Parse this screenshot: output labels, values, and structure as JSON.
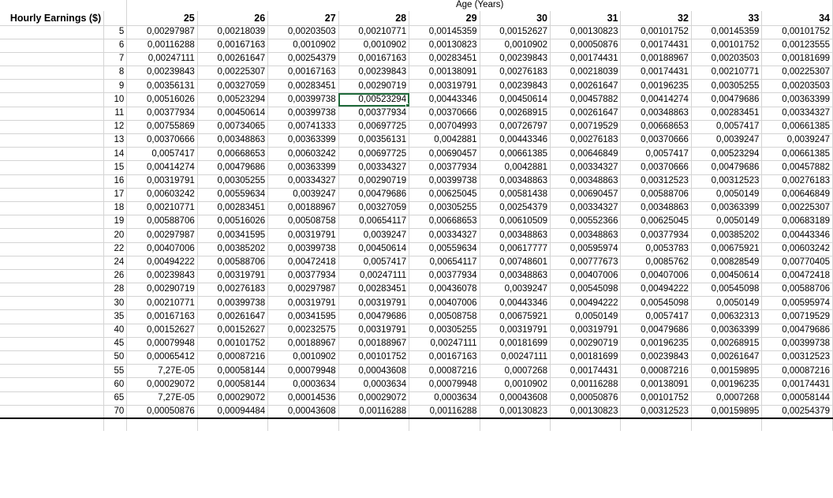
{
  "header": {
    "banner_title": "Age (Years)",
    "row_axis_label": "Hourly Earnings ($)",
    "columns": [
      "25",
      "26",
      "27",
      "28",
      "29",
      "30",
      "31",
      "32",
      "33",
      "34"
    ]
  },
  "selection": {
    "row_label": "10",
    "column_label": "28",
    "value": "0,00523294",
    "border_color": "#1f6b3b"
  },
  "chart_data": {
    "type": "table",
    "title": "Age (Years)",
    "xlabel": "Age (Years)",
    "ylabel": "Hourly Earnings ($)",
    "categories": [
      "25",
      "26",
      "27",
      "28",
      "29",
      "30",
      "31",
      "32",
      "33",
      "34"
    ],
    "row_labels": [
      "5",
      "6",
      "7",
      "8",
      "9",
      "10",
      "11",
      "12",
      "13",
      "14",
      "15",
      "16",
      "17",
      "18",
      "19",
      "20",
      "22",
      "24",
      "26",
      "28",
      "30",
      "35",
      "40",
      "45",
      "50",
      "55",
      "60",
      "65",
      "70"
    ],
    "rows": [
      {
        "label": "5",
        "values": [
          "0,00297987",
          "0,00218039",
          "0,00203503",
          "0,00210771",
          "0,00145359",
          "0,00152627",
          "0,00130823",
          "0,00101752",
          "0,00145359",
          "0,00101752"
        ]
      },
      {
        "label": "6",
        "values": [
          "0,00116288",
          "0,00167163",
          "0,0010902",
          "0,0010902",
          "0,00130823",
          "0,0010902",
          "0,00050876",
          "0,00174431",
          "0,00101752",
          "0,00123555"
        ]
      },
      {
        "label": "7",
        "values": [
          "0,00247111",
          "0,00261647",
          "0,00254379",
          "0,00167163",
          "0,00283451",
          "0,00239843",
          "0,00174431",
          "0,00188967",
          "0,00203503",
          "0,00181699"
        ]
      },
      {
        "label": "8",
        "values": [
          "0,00239843",
          "0,00225307",
          "0,00167163",
          "0,00239843",
          "0,00138091",
          "0,00276183",
          "0,00218039",
          "0,00174431",
          "0,00210771",
          "0,00225307"
        ]
      },
      {
        "label": "9",
        "values": [
          "0,00356131",
          "0,00327059",
          "0,00283451",
          "0,00290719",
          "0,00319791",
          "0,00239843",
          "0,00261647",
          "0,00196235",
          "0,00305255",
          "0,00203503"
        ]
      },
      {
        "label": "10",
        "values": [
          "0,00516026",
          "0,00523294",
          "0,00399738",
          "0,00523294",
          "0,00443346",
          "0,00450614",
          "0,00457882",
          "0,00414274",
          "0,00479686",
          "0,00363399"
        ]
      },
      {
        "label": "11",
        "values": [
          "0,00377934",
          "0,00450614",
          "0,00399738",
          "0,00377934",
          "0,00370666",
          "0,00268915",
          "0,00261647",
          "0,00348863",
          "0,00283451",
          "0,00334327"
        ]
      },
      {
        "label": "12",
        "values": [
          "0,00755869",
          "0,00734065",
          "0,00741333",
          "0,00697725",
          "0,00704993",
          "0,00726797",
          "0,00719529",
          "0,00668653",
          "0,0057417",
          "0,00661385"
        ]
      },
      {
        "label": "13",
        "values": [
          "0,00370666",
          "0,00348863",
          "0,00363399",
          "0,00356131",
          "0,0042881",
          "0,00443346",
          "0,00276183",
          "0,00370666",
          "0,0039247",
          "0,0039247"
        ]
      },
      {
        "label": "14",
        "values": [
          "0,0057417",
          "0,00668653",
          "0,00603242",
          "0,00697725",
          "0,00690457",
          "0,00661385",
          "0,00646849",
          "0,0057417",
          "0,00523294",
          "0,00661385"
        ]
      },
      {
        "label": "15",
        "values": [
          "0,00414274",
          "0,00479686",
          "0,00363399",
          "0,00334327",
          "0,00377934",
          "0,0042881",
          "0,00334327",
          "0,00370666",
          "0,00479686",
          "0,00457882"
        ]
      },
      {
        "label": "16",
        "values": [
          "0,00319791",
          "0,00305255",
          "0,00334327",
          "0,00290719",
          "0,00399738",
          "0,00348863",
          "0,00348863",
          "0,00312523",
          "0,00312523",
          "0,00276183"
        ]
      },
      {
        "label": "17",
        "values": [
          "0,00603242",
          "0,00559634",
          "0,0039247",
          "0,00479686",
          "0,00625045",
          "0,00581438",
          "0,00690457",
          "0,00588706",
          "0,0050149",
          "0,00646849"
        ]
      },
      {
        "label": "18",
        "values": [
          "0,00210771",
          "0,00283451",
          "0,00188967",
          "0,00327059",
          "0,00305255",
          "0,00254379",
          "0,00334327",
          "0,00348863",
          "0,00363399",
          "0,00225307"
        ]
      },
      {
        "label": "19",
        "values": [
          "0,00588706",
          "0,00516026",
          "0,00508758",
          "0,00654117",
          "0,00668653",
          "0,00610509",
          "0,00552366",
          "0,00625045",
          "0,0050149",
          "0,00683189"
        ]
      },
      {
        "label": "20",
        "values": [
          "0,00297987",
          "0,00341595",
          "0,00319791",
          "0,0039247",
          "0,00334327",
          "0,00348863",
          "0,00348863",
          "0,00377934",
          "0,00385202",
          "0,00443346"
        ]
      },
      {
        "label": "22",
        "values": [
          "0,00407006",
          "0,00385202",
          "0,00399738",
          "0,00450614",
          "0,00559634",
          "0,00617777",
          "0,00595974",
          "0,0053783",
          "0,00675921",
          "0,00603242"
        ]
      },
      {
        "label": "24",
        "values": [
          "0,00494222",
          "0,00588706",
          "0,00472418",
          "0,0057417",
          "0,00654117",
          "0,00748601",
          "0,00777673",
          "0,0085762",
          "0,00828549",
          "0,00770405"
        ]
      },
      {
        "label": "26",
        "values": [
          "0,00239843",
          "0,00319791",
          "0,00377934",
          "0,00247111",
          "0,00377934",
          "0,00348863",
          "0,00407006",
          "0,00407006",
          "0,00450614",
          "0,00472418"
        ]
      },
      {
        "label": "28",
        "values": [
          "0,00290719",
          "0,00276183",
          "0,00297987",
          "0,00283451",
          "0,00436078",
          "0,0039247",
          "0,00545098",
          "0,00494222",
          "0,00545098",
          "0,00588706"
        ]
      },
      {
        "label": "30",
        "values": [
          "0,00210771",
          "0,00399738",
          "0,00319791",
          "0,00319791",
          "0,00407006",
          "0,00443346",
          "0,00494222",
          "0,00545098",
          "0,0050149",
          "0,00595974"
        ]
      },
      {
        "label": "35",
        "values": [
          "0,00167163",
          "0,00261647",
          "0,00341595",
          "0,00479686",
          "0,00508758",
          "0,00675921",
          "0,0050149",
          "0,0057417",
          "0,00632313",
          "0,00719529"
        ]
      },
      {
        "label": "40",
        "values": [
          "0,00152627",
          "0,00152627",
          "0,00232575",
          "0,00319791",
          "0,00305255",
          "0,00319791",
          "0,00319791",
          "0,00479686",
          "0,00363399",
          "0,00479686"
        ]
      },
      {
        "label": "45",
        "values": [
          "0,00079948",
          "0,00101752",
          "0,00188967",
          "0,00188967",
          "0,00247111",
          "0,00181699",
          "0,00290719",
          "0,00196235",
          "0,00268915",
          "0,00399738"
        ]
      },
      {
        "label": "50",
        "values": [
          "0,00065412",
          "0,00087216",
          "0,0010902",
          "0,00101752",
          "0,00167163",
          "0,00247111",
          "0,00181699",
          "0,00239843",
          "0,00261647",
          "0,00312523"
        ]
      },
      {
        "label": "55",
        "values": [
          "7,27E-05",
          "0,00058144",
          "0,00079948",
          "0,00043608",
          "0,00087216",
          "0,0007268",
          "0,00174431",
          "0,00087216",
          "0,00159895",
          "0,00087216"
        ]
      },
      {
        "label": "60",
        "values": [
          "0,00029072",
          "0,00058144",
          "0,0003634",
          "0,0003634",
          "0,00079948",
          "0,0010902",
          "0,00116288",
          "0,00138091",
          "0,00196235",
          "0,00174431"
        ]
      },
      {
        "label": "65",
        "values": [
          "7,27E-05",
          "0,00029072",
          "0,00014536",
          "0,00029072",
          "0,0003634",
          "0,00043608",
          "0,00050876",
          "0,00101752",
          "0,0007268",
          "0,00058144"
        ]
      },
      {
        "label": "70",
        "values": [
          "0,00050876",
          "0,00094484",
          "0,00043608",
          "0,00116288",
          "0,00116288",
          "0,00130823",
          "0,00130823",
          "0,00312523",
          "0,00159895",
          "0,00254379"
        ]
      }
    ]
  }
}
